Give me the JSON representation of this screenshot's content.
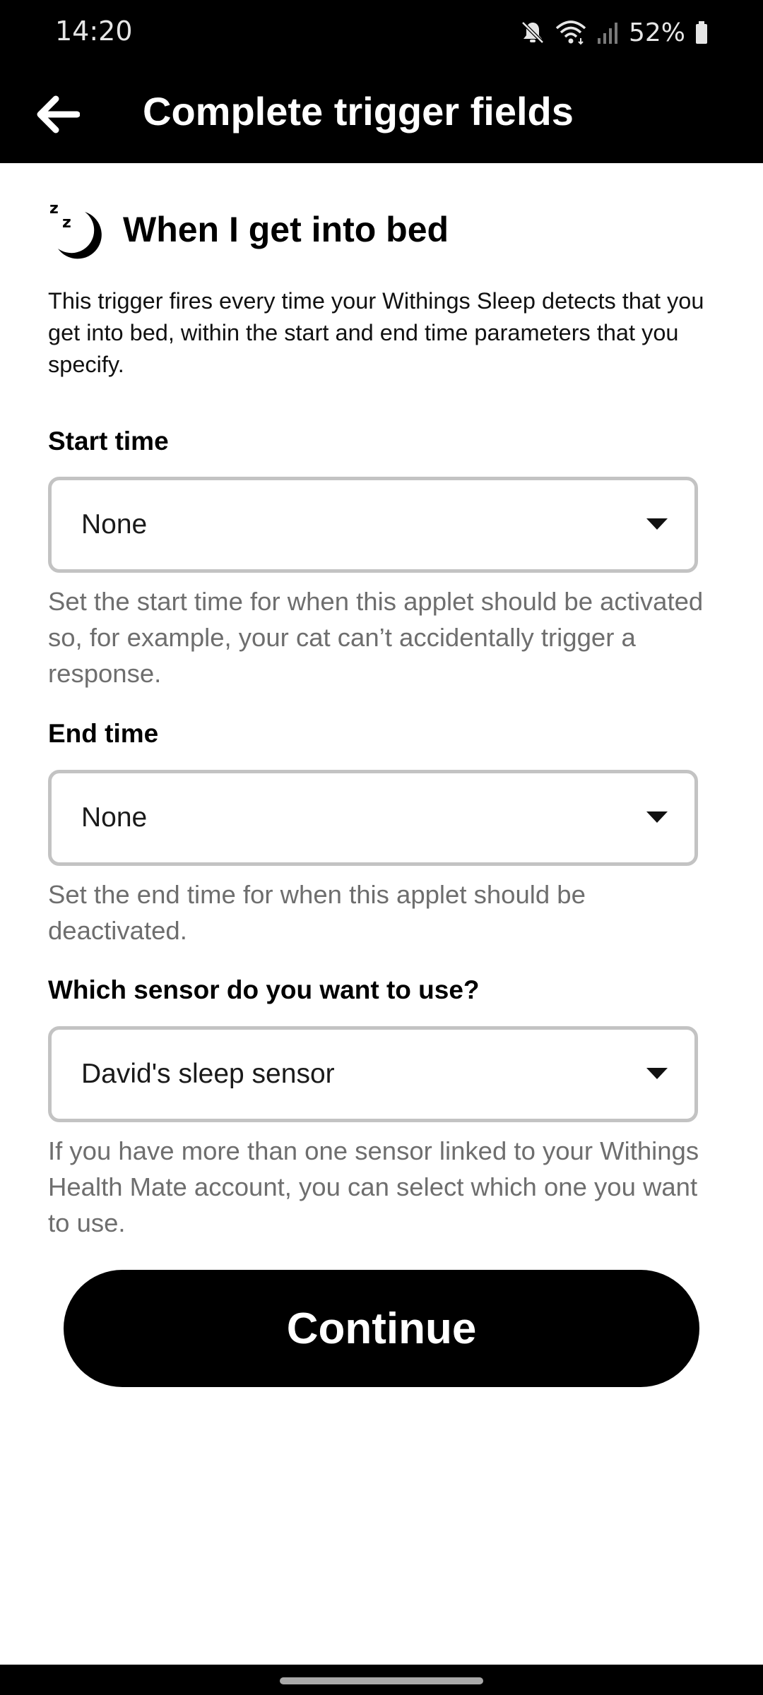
{
  "status_bar": {
    "time": "14:20",
    "battery": "52%",
    "icons": [
      "mute-icon",
      "wifi-icon",
      "signal-icon",
      "battery-icon"
    ]
  },
  "app_bar": {
    "back_icon": "arrow-left-icon",
    "title": "Complete trigger fields"
  },
  "trigger": {
    "icon": "sleep-moon-icon",
    "title": "When I get into bed",
    "description": "This trigger fires every time your Withings Sleep detects that you get into bed, within the start and end time parameters that you specify."
  },
  "fields": {
    "start_time": {
      "label": "Start time",
      "value": "None",
      "help": "Set the start time for when this applet should be activated so, for example, your cat can’t accidentally trigger a response."
    },
    "end_time": {
      "label": "End time",
      "value": "None",
      "help": "Set the end time for when this applet should be deactivated."
    },
    "sensor": {
      "label": "Which sensor do you want to use?",
      "value": "David's sleep sensor",
      "help": "If you have more than one sensor linked to your Withings Health Mate account, you can select which one you want to use."
    }
  },
  "actions": {
    "continue_label": "Continue"
  },
  "colors": {
    "header_background": "#000000",
    "button_background": "#000000",
    "help_text": "#6e6e6e",
    "select_border": "#c3c3c3"
  }
}
